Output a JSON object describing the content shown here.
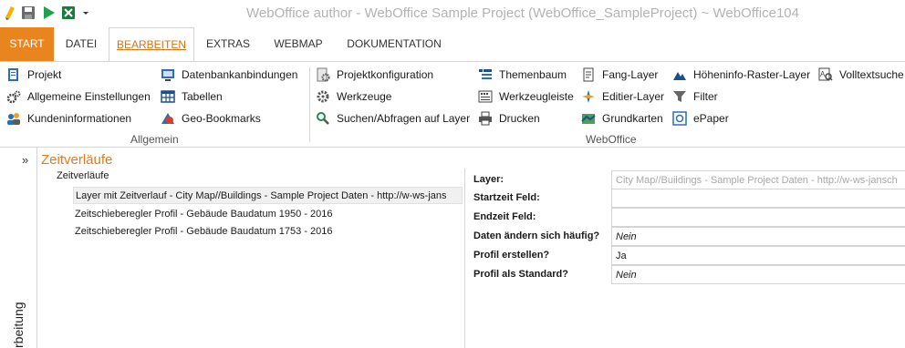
{
  "window": {
    "title": "WebOffice author - WebOffice Sample Project (WebOffice_SampleProject) ~ WebOffice104"
  },
  "quick_access": [
    {
      "name": "pencil-icon"
    },
    {
      "name": "save-icon"
    },
    {
      "name": "play-icon"
    },
    {
      "name": "excel-icon"
    },
    {
      "name": "customize-dropdown-icon"
    }
  ],
  "tabs": [
    {
      "label": "START"
    },
    {
      "label": "DATEI"
    },
    {
      "label": "BEARBEITEN"
    },
    {
      "label": "EXTRAS"
    },
    {
      "label": "WEBMAP"
    },
    {
      "label": "DOKUMENTATION"
    }
  ],
  "ribbon": {
    "groups": [
      {
        "label": "Allgemein"
      },
      {
        "label": "WebOffice"
      }
    ],
    "items": [
      {
        "label": "Projekt",
        "icon": "project-icon"
      },
      {
        "label": "Allgemeine Einstellungen",
        "icon": "settings-gear-icon"
      },
      {
        "label": "Kundeninformationen",
        "icon": "customers-icon"
      },
      {
        "label": "Datenbankanbindungen",
        "icon": "database-connection-icon"
      },
      {
        "label": "Tabellen",
        "icon": "table-icon"
      },
      {
        "label": "Geo-Bookmarks",
        "icon": "geo-bookmark-icon"
      },
      {
        "label": "Projektkonfiguration",
        "icon": "project-config-icon"
      },
      {
        "label": "Werkzeuge",
        "icon": "tools-icon"
      },
      {
        "label": "Suchen/Abfragen auf Layer",
        "icon": "search-query-icon"
      },
      {
        "label": "Themenbaum",
        "icon": "theme-tree-icon"
      },
      {
        "label": "Werkzeugleiste",
        "icon": "toolbar-icon"
      },
      {
        "label": "Drucken",
        "icon": "print-icon"
      },
      {
        "label": "Fang-Layer",
        "icon": "snap-layer-icon"
      },
      {
        "label": "Editier-Layer",
        "icon": "edit-layer-icon"
      },
      {
        "label": "Grundkarten",
        "icon": "basemap-icon"
      },
      {
        "label": "Höheninfo-Raster-Layer",
        "icon": "elevation-raster-icon"
      },
      {
        "label": "Filter",
        "icon": "filter-icon"
      },
      {
        "label": "ePaper",
        "icon": "epaper-icon"
      },
      {
        "label": "Volltextsuche",
        "icon": "fulltext-search-icon"
      }
    ]
  },
  "left_pane": {
    "expand_glyph": "»",
    "vertical_label": "rbeitung"
  },
  "content": {
    "title": "Zeitverläufe",
    "tree_root": "Zeitverläufe",
    "tree_items": [
      {
        "label": "Layer mit Zeitverlauf - City Map//Buildings - Sample Project Daten - http://w-ws-jans"
      },
      {
        "label": "Zeitschieberegler Profil - Gebäude Baudatum 1950 - 2016"
      },
      {
        "label": "Zeitschieberegler Profil - Gebäude Baudatum 1753 - 2016"
      }
    ]
  },
  "properties": [
    {
      "label": "Layer:",
      "value": "City Map//Buildings - Sample Project Daten - http://w-ws-jansch"
    },
    {
      "label": "Startzeit Feld:",
      "value": ""
    },
    {
      "label": "Endzeit Feld:",
      "value": ""
    },
    {
      "label": "Daten ändern sich häufig?",
      "value": "Nein"
    },
    {
      "label": "Profil erstellen?",
      "value": "Ja"
    },
    {
      "label": "Profil als Standard?",
      "value": "Nein"
    }
  ]
}
